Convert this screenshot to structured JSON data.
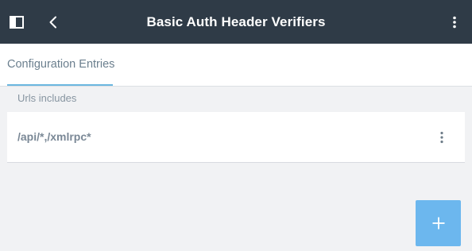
{
  "header": {
    "title": "Basic Auth Header Verifiers",
    "left_icons": [
      "sidebar-toggle-icon",
      "chevron-left-icon"
    ],
    "right_icon": "more-vertical-icon",
    "background_color": "#2f3b47"
  },
  "tabs": [
    {
      "label": "Configuration Entries",
      "active": true
    }
  ],
  "section": {
    "label": "Urls includes"
  },
  "list": {
    "items": [
      {
        "value": "/api/*,/xmlrpc*",
        "menu_icon": "more-vertical-icon"
      }
    ]
  },
  "fab": {
    "icon": "plus-icon",
    "color": "#6cb7ee"
  },
  "colors": {
    "accent": "#6cb7e0",
    "page_background": "#f1f2f4"
  }
}
